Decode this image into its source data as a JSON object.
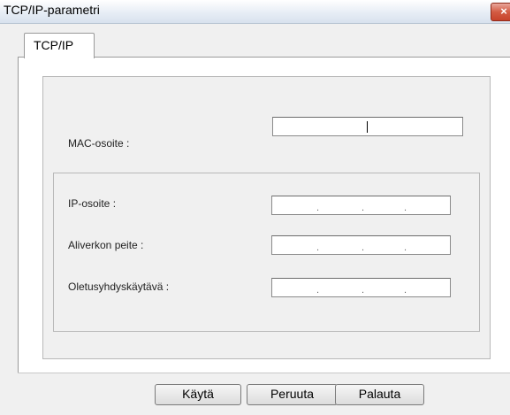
{
  "window": {
    "title": "TCP/IP-parametri",
    "close_label": "×"
  },
  "tabs": [
    {
      "label": "TCP/IP"
    }
  ],
  "form": {
    "mac": {
      "label": "MAC-osoite :",
      "value": ""
    },
    "ip": {
      "label": "IP-osoite :",
      "value": ""
    },
    "subnet": {
      "label": "Aliverkon peite :",
      "value": ""
    },
    "gateway": {
      "label": "Oletusyhdyskäytävä :",
      "value": ""
    }
  },
  "buttons": {
    "apply": "Käytä",
    "cancel": "Peruuta",
    "restore": "Palauta"
  }
}
